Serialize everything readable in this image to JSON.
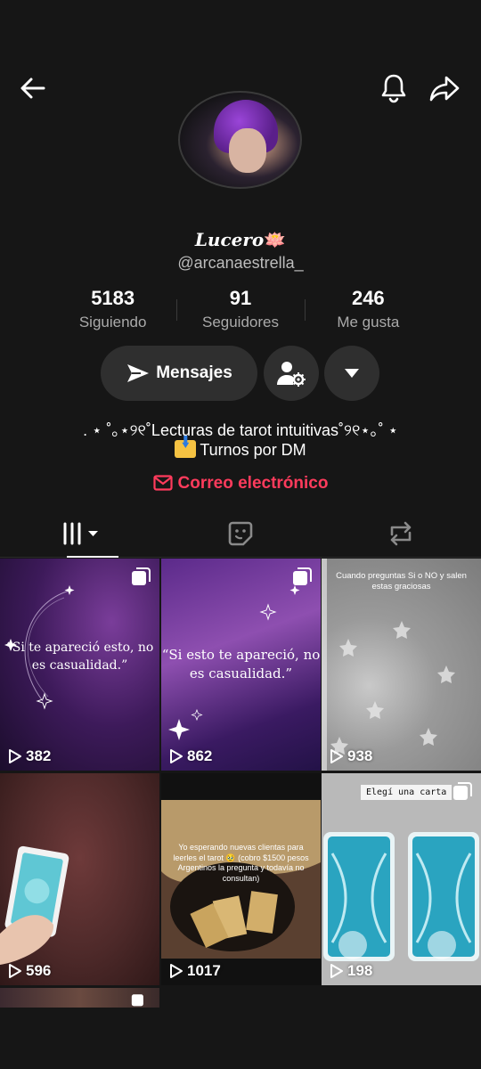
{
  "profile": {
    "display_name": "Lucero",
    "display_emoji": "🪷",
    "handle": "@arcanaestrella_"
  },
  "stats": [
    {
      "value": "5183",
      "label": "Siguiendo"
    },
    {
      "value": "91",
      "label": "Seguidores"
    },
    {
      "value": "246",
      "label": "Me gusta"
    }
  ],
  "actions": {
    "message_label": "Mensajes"
  },
  "bio": {
    "line1": ". ⋆ ˚｡⋆୨୧˚Lecturas de tarot intuitivas˚୨୧⋆｡˚ ⋆",
    "line2": "Turnos por DM",
    "email_label": "Correo electrónico"
  },
  "icons": {
    "back": "arrow-left-icon",
    "bell": "bell-icon",
    "share": "share-icon",
    "message": "send-icon",
    "settings": "user-settings-icon",
    "more": "caret-down-icon",
    "email": "envelope-icon",
    "tab_videos": "grid-icon",
    "tab_reposts_emoji": "sticker-icon",
    "tab_reposts": "repost-icon",
    "views": "play-icon"
  },
  "videos": [
    {
      "views": "382",
      "text": "“Si te apareció esto, no es casualidad.”"
    },
    {
      "views": "862",
      "text": "“Si esto te apareció, no es casualidad.”"
    },
    {
      "views": "938",
      "text": "Cuando preguntas Si o NO y salen estas graciosas"
    },
    {
      "views": "596",
      "text": ""
    },
    {
      "views": "1017",
      "text": "Yo esperando nuevas clientas para leerles el tarot 🥹 (cobro $1500 pesos Argentinos la pregunta y todavía no consultan)"
    },
    {
      "views": "198",
      "text": "Elegí una carta"
    }
  ],
  "colors": {
    "background": "#161616",
    "accent": "#ff3b5c",
    "button": "#2f2f2f",
    "muted": "#aaaaaa"
  }
}
